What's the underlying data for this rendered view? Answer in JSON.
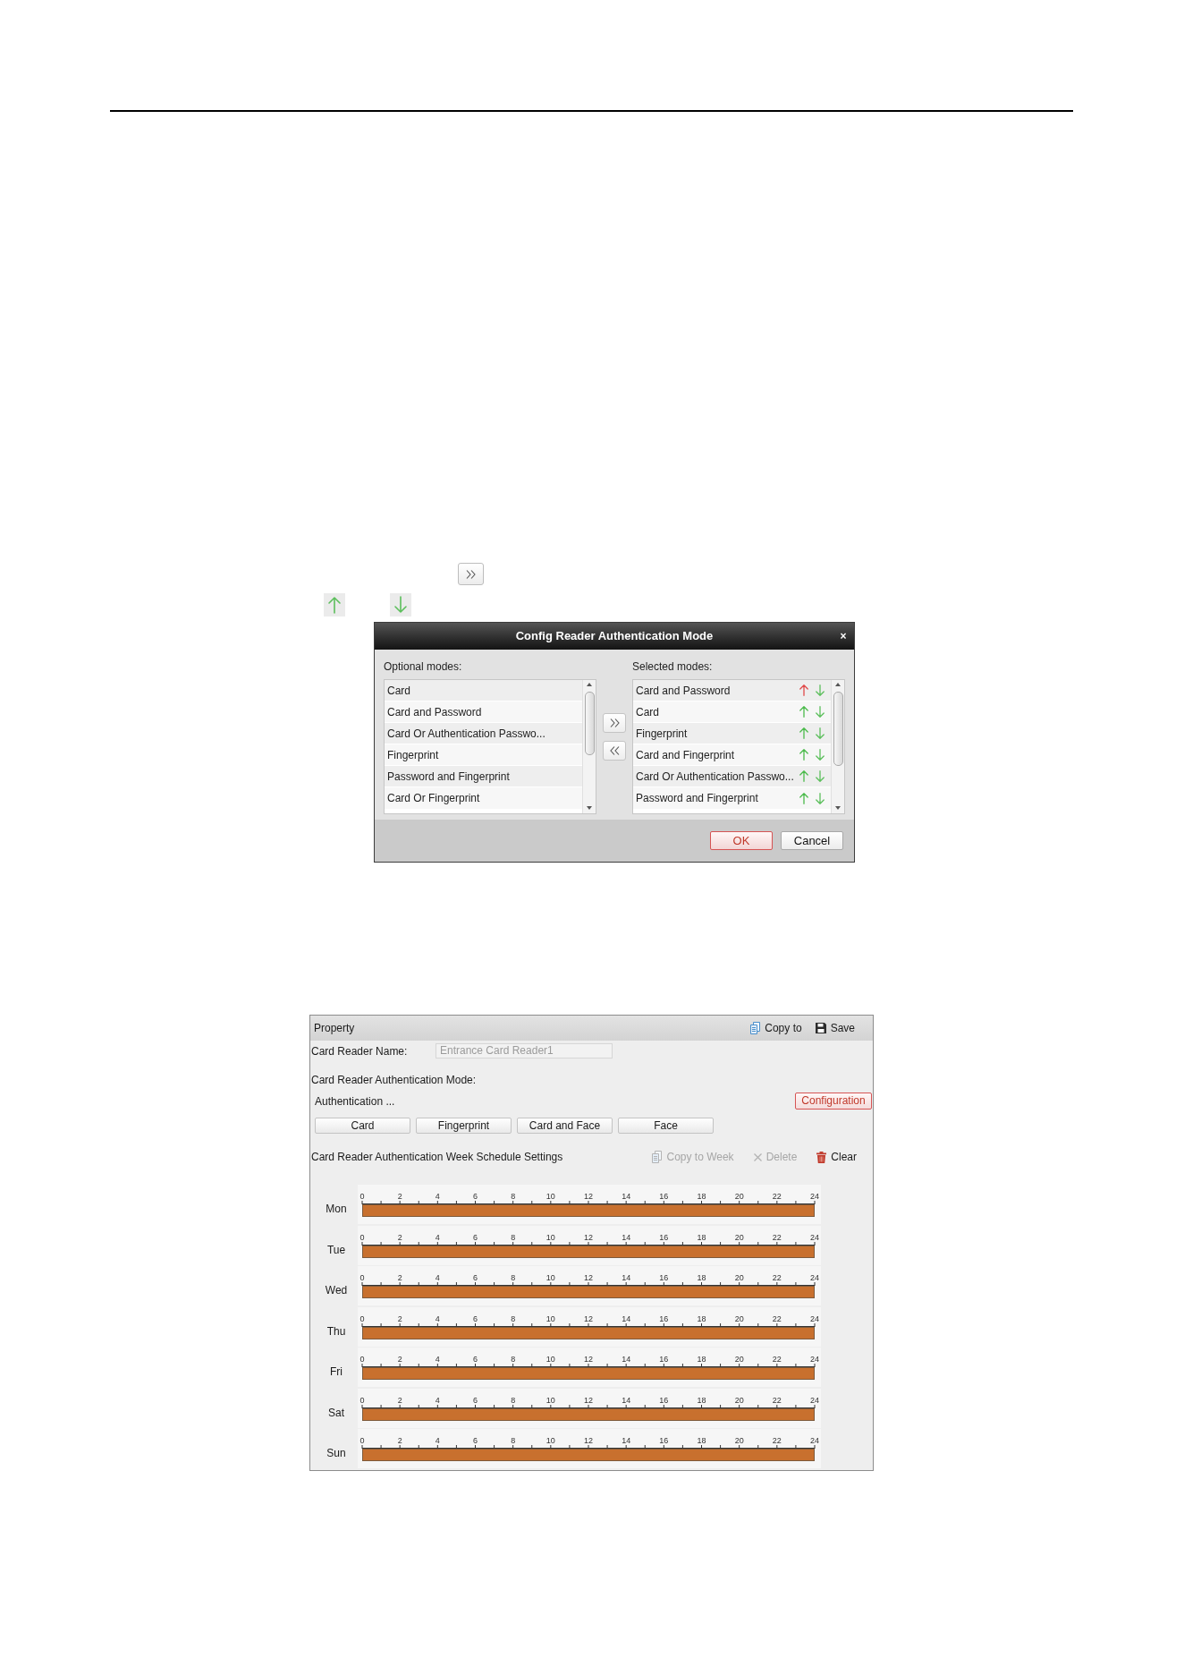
{
  "inline_icon_rows": [
    {
      "items": [
        {
          "kind": "add_button"
        }
      ]
    },
    {
      "items": [
        {
          "kind": "up_arrow"
        },
        {
          "kind": "down_arrow"
        }
      ]
    }
  ],
  "dialog": {
    "title": "Config Reader Authentication Mode",
    "close": "×",
    "optional_modes": {
      "label": "Optional modes:",
      "items": [
        {
          "label": "Card",
          "selected": false
        },
        {
          "label": "Card and Password",
          "selected": false
        },
        {
          "label": "Card Or Authentication Passwo...",
          "selected": false
        },
        {
          "label": "Fingerprint",
          "selected": false
        },
        {
          "label": "Password and Fingerprint",
          "selected": false
        },
        {
          "label": "Card Or Fingerprint",
          "selected": false
        }
      ]
    },
    "transfer_buttons": [
      {
        "kind": "add"
      },
      {
        "kind": "remove"
      }
    ],
    "selected_modes": {
      "label": "Selected modes:",
      "items": [
        {
          "label": "Card and Password",
          "selected": false,
          "up_arrow": {
            "color": "#e04b4b"
          }
        },
        {
          "label": "Card",
          "selected": false,
          "up_arrow": {
            "color": "#4cbb4c"
          }
        },
        {
          "label": "Fingerprint",
          "selected": false,
          "up_arrow": {
            "color": "#4cbb4c"
          }
        },
        {
          "label": "Card and Fingerprint",
          "selected": false,
          "up_arrow": {
            "color": "#4cbb4c"
          }
        },
        {
          "label": "Card Or Authentication Passwo...",
          "selected": false,
          "up_arrow": {
            "color": "#4cbb4c"
          }
        },
        {
          "label": "Password and Fingerprint",
          "selected": false,
          "up_arrow": {
            "color": "#4cbb4c"
          }
        }
      ]
    },
    "buttons": [
      {
        "label": "OK",
        "kind": "primary"
      },
      {
        "label": "Cancel",
        "kind": "normal"
      }
    ]
  },
  "property_panel": {
    "title": "Property",
    "actions": [
      {
        "kind": "copy",
        "label": "Copy to"
      },
      {
        "kind": "save",
        "label": "Save"
      }
    ],
    "name_field": {
      "label": "Card Reader Name:",
      "value": "Entrance Card Reader1",
      "disabled": true
    },
    "mode_label": "Card Reader Authentication Mode:",
    "mode_summary": "Authentication ...",
    "configuration_button": "Configuration",
    "mode_buttons": [
      "Card",
      "Fingerprint",
      "Card and Face",
      "Face"
    ],
    "schedule": {
      "title": "Card Reader Authentication Week Schedule Settings",
      "actions": [
        {
          "kind": "copy_week",
          "label": "Copy to Week",
          "disabled": true
        },
        {
          "kind": "delete",
          "label": "Delete",
          "disabled": true
        },
        {
          "kind": "clear",
          "label": "Clear",
          "disabled": false
        }
      ],
      "days": [
        {
          "day": "Mon",
          "ticks": [
            "0",
            "2",
            "4",
            "6",
            "8",
            "10",
            "12",
            "14",
            "16",
            "18",
            "20",
            "22",
            "24"
          ],
          "level": 1
        },
        {
          "day": "Tue",
          "ticks": [
            "0",
            "2",
            "4",
            "6",
            "8",
            "10",
            "12",
            "14",
            "16",
            "18",
            "20",
            "22",
            "24"
          ],
          "level": 1
        },
        {
          "day": "Wed",
          "ticks": [
            "0",
            "2",
            "4",
            "6",
            "8",
            "10",
            "12",
            "14",
            "16",
            "18",
            "20",
            "22",
            "24"
          ],
          "level": 1
        },
        {
          "day": "Thu",
          "ticks": [
            "0",
            "2",
            "4",
            "6",
            "8",
            "10",
            "12",
            "14",
            "16",
            "18",
            "20",
            "22",
            "24"
          ],
          "level": 1
        },
        {
          "day": "Fri",
          "ticks": [
            "0",
            "2",
            "4",
            "6",
            "8",
            "10",
            "12",
            "14",
            "16",
            "18",
            "20",
            "22",
            "24"
          ],
          "level": 1
        },
        {
          "day": "Sat",
          "ticks": [
            "0",
            "2",
            "4",
            "6",
            "8",
            "10",
            "12",
            "14",
            "16",
            "18",
            "20",
            "22",
            "24"
          ],
          "level": 1
        },
        {
          "day": "Sun",
          "ticks": [
            "0",
            "2",
            "4",
            "6",
            "8",
            "10",
            "12",
            "14",
            "16",
            "18",
            "20",
            "22",
            "24"
          ],
          "level": 1
        }
      ]
    }
  }
}
